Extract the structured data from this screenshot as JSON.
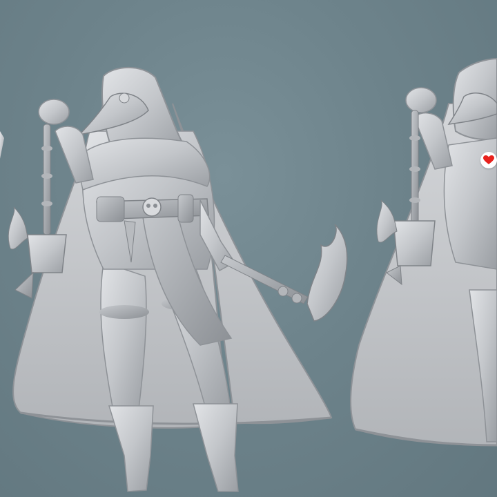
{
  "scene": {
    "background": "#6b8088",
    "subject": "sculpt-render",
    "model_color": "#c8cbcf"
  },
  "favorite": {
    "icon": "heart-icon",
    "color": "#e8211c"
  }
}
